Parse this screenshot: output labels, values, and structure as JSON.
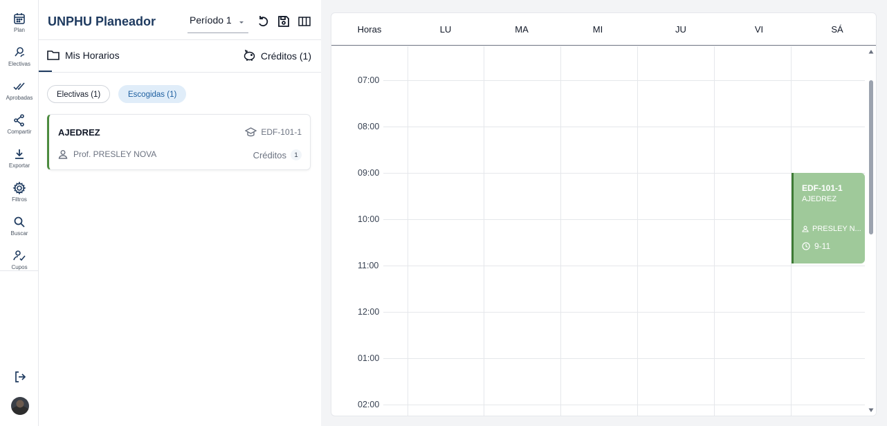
{
  "rail": {
    "items": [
      {
        "label": "Plan",
        "icon": "calendar-icon"
      },
      {
        "label": "Electivas",
        "icon": "person-search-icon"
      },
      {
        "label": "Aprobadas",
        "icon": "double-check-icon"
      },
      {
        "label": "Compartir",
        "icon": "share-icon"
      },
      {
        "label": "Exportar",
        "icon": "download-icon"
      },
      {
        "label": "Filtros",
        "icon": "gear-icon"
      },
      {
        "label": "Buscar",
        "icon": "search-icon"
      },
      {
        "label": "Cupos",
        "icon": "person-check-icon"
      }
    ]
  },
  "header": {
    "title": "UNPHU Planeador",
    "periodo": "Período 1"
  },
  "tabs": {
    "mis_horarios": "Mis Horarios",
    "creditos": "Créditos (1)"
  },
  "chips": {
    "electivas": "Electivas (1)",
    "escogidas": "Escogidas (1)"
  },
  "course": {
    "name": "AJEDREZ",
    "code": "EDF-101-1",
    "prof": "Prof. PRESLEY NOVA",
    "creditos_label": "Créditos",
    "creditos_value": "1"
  },
  "calendar": {
    "horas_label": "Horas",
    "days": [
      "LU",
      "MA",
      "MI",
      "JU",
      "VI",
      "SÁ"
    ],
    "times": [
      "07:00",
      "08:00",
      "09:00",
      "10:00",
      "11:00",
      "12:00",
      "01:00",
      "02:00"
    ],
    "event": {
      "code": "EDF-101-1",
      "name": "AJEDREZ",
      "prof": "PRESLEY N...",
      "time": "9-11",
      "day": "SÁ",
      "start": "09:00",
      "end": "11:00"
    }
  },
  "colors": {
    "brand": "#1e3a5f",
    "event_fill": "#9fc99a",
    "event_border": "#3d7a34",
    "chip_active": "#e0edf9"
  }
}
